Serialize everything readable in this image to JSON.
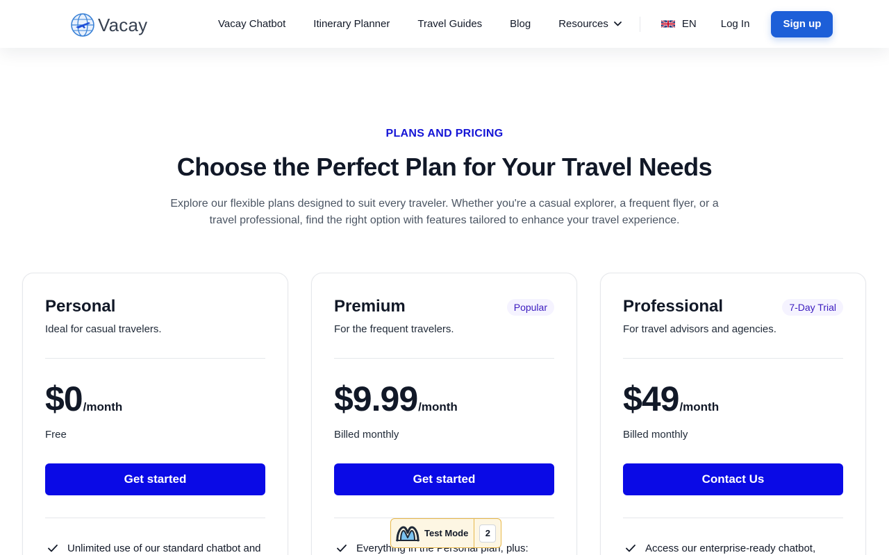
{
  "header": {
    "logo_text": "Vacay",
    "nav": [
      "Vacay Chatbot",
      "Itinerary Planner",
      "Travel Guides",
      "Blog",
      "Resources"
    ],
    "language": "EN",
    "login_label": "Log In",
    "signup_label": "Sign up"
  },
  "hero": {
    "eyebrow": "PLANS AND PRICING",
    "title": "Choose the Perfect Plan for Your Travel Needs",
    "subtitle": "Explore our flexible plans designed to suit every traveler. Whether you're a casual explorer, a frequent flyer, or a travel professional, find the right option with features tailored to enhance your travel experience."
  },
  "plans": [
    {
      "name": "Personal",
      "badge": "",
      "description": "Ideal for casual travelers.",
      "price": "$0",
      "period": "/month",
      "billing": "Free",
      "cta": "Get started",
      "feature": "Unlimited use of our standard chatbot and"
    },
    {
      "name": "Premium",
      "badge": "Popular",
      "description": "For the frequent travelers.",
      "price": "$9.99",
      "period": "/month",
      "billing": "Billed monthly",
      "cta": "Get started",
      "feature": "Everything in the Personal plan, plus:"
    },
    {
      "name": "Professional",
      "badge": "7-Day Trial",
      "description": "For travel advisors and agencies.",
      "price": "$49",
      "period": "/month",
      "billing": "Billed monthly",
      "cta": "Contact Us",
      "feature": "Access our enterprise-ready chatbot,"
    }
  ],
  "test_mode": {
    "label": "Test Mode",
    "count": "2"
  },
  "colors": {
    "primary_button": "#0a0ae6",
    "signup_button": "#1d5fd8",
    "eyebrow": "#1414d6",
    "badge_text": "#3b1bbf",
    "test_mode_border": "#e8b84a"
  },
  "icons": [
    "globe-plane-logo-icon",
    "chevron-down-icon",
    "uk-flag-icon",
    "check-icon",
    "test-mode-logo-icon"
  ]
}
